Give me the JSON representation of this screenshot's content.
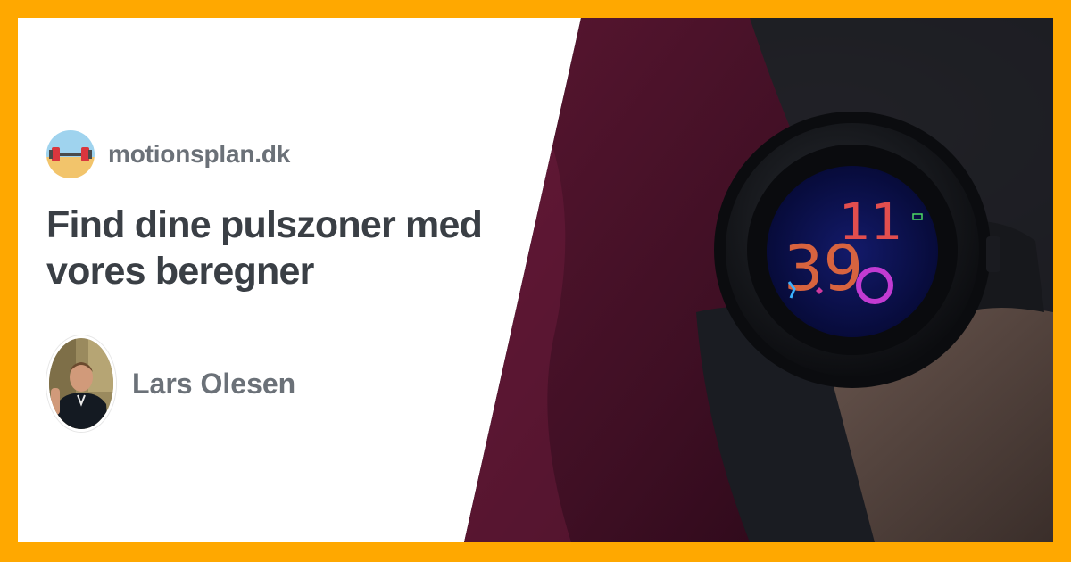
{
  "site": {
    "name": "motionsplan.dk",
    "logo_icon": "dumbbell-beach-icon"
  },
  "article": {
    "title": "Find dine pulszoner med vores beregner"
  },
  "author": {
    "name": "Lars Olesen",
    "avatar_icon": "author-portrait"
  },
  "hero_image": {
    "icon": "smartwatch-on-wrist-photo",
    "watch_face": {
      "hour": "11",
      "minute": "39"
    }
  },
  "colors": {
    "frame": "#ffa800",
    "card": "#ffffff",
    "title": "#3a3f45",
    "muted": "#6b7178"
  }
}
